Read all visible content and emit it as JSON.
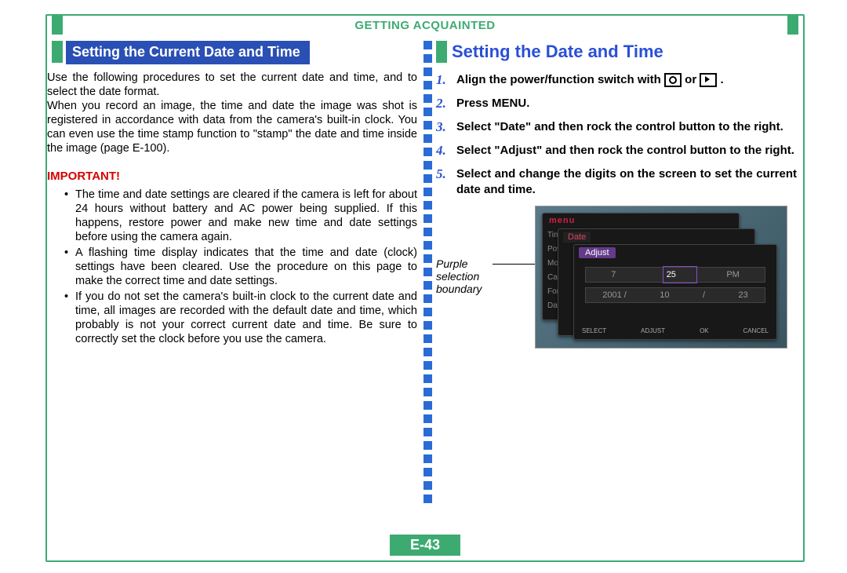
{
  "header": {
    "section_title": "GETTING ACQUAINTED"
  },
  "page_number": "E-43",
  "left": {
    "heading": "Setting the Current Date and Time",
    "para1": "Use the following procedures to set the current date and time, and to select the date format.",
    "para2": "When you record an image, the time and date the image was shot is registered in accordance with data from the camera's built-in clock. You can even use the time stamp function to \"stamp\" the date and time inside the image (page E-100).",
    "important_label": "IMPORTANT!",
    "bullets": [
      "The time and date settings are cleared if the camera is left for about 24 hours without battery and AC power being supplied. If this happens, restore power and make new time and date settings before using the camera again.",
      "A flashing time display indicates that the time and date (clock) settings have been cleared. Use the procedure on this page to make the correct time and date settings.",
      "If you do not set the camera's built-in clock to the current date and time, all images are recorded with the default date and time, which probably is not your correct current date and time. Be sure to correctly set the clock before you use the camera."
    ]
  },
  "right": {
    "heading": "Setting the Date and Time",
    "steps": [
      {
        "n": "1.",
        "pre": "Align the power/function switch with ",
        "mid": " or ",
        "post": "."
      },
      {
        "n": "2.",
        "text": "Press MENU."
      },
      {
        "n": "3.",
        "text": "Select \"Date\" and then rock the control button to the right."
      },
      {
        "n": "4.",
        "text": "Select \"Adjust\" and then rock the control button to the right."
      },
      {
        "n": "5.",
        "text": "Select and change the digits on the screen to set the current date and time."
      }
    ],
    "callout": "Purple\nselection\nboundary",
    "lcd": {
      "menu_word": "menu",
      "w1_side": [
        "Time",
        "Pow",
        "Mo",
        "Card",
        "Form",
        "Date"
      ],
      "w2_tab": "Date",
      "w3_tab": "Adjust",
      "row1": [
        "7",
        "25",
        "PM"
      ],
      "row2": [
        "2001 /",
        "10",
        "/",
        "23"
      ],
      "bottom": [
        "SELECT",
        "ADJUST",
        "OK",
        "CANCEL"
      ]
    }
  }
}
